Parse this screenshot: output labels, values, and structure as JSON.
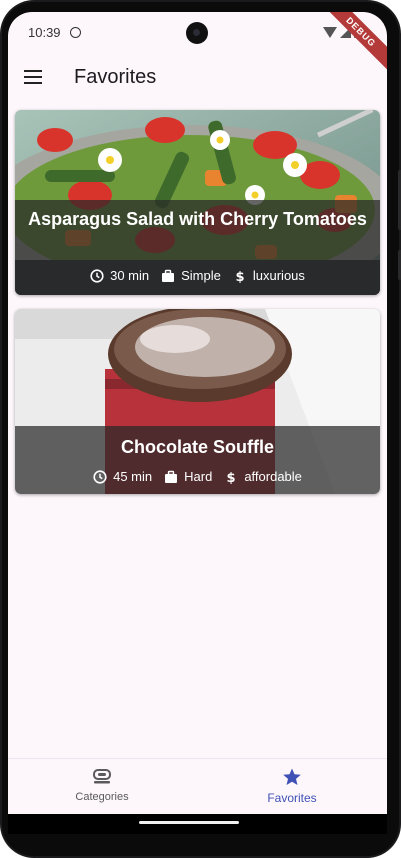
{
  "status_bar": {
    "time": "10:39"
  },
  "debug_banner": "DEBUG",
  "app_bar": {
    "title": "Favorites"
  },
  "meals": [
    {
      "title": "Asparagus Salad with Cherry Tomatoes",
      "duration": "30 min",
      "complexity": "Simple",
      "affordability": "luxurious"
    },
    {
      "title": "Chocolate Souffle",
      "duration": "45 min",
      "complexity": "Hard",
      "affordability": "affordable"
    }
  ],
  "bottom_nav": {
    "items": [
      {
        "label": "Categories",
        "icon": "dinner-dining-icon",
        "selected": false
      },
      {
        "label": "Favorites",
        "icon": "star-icon",
        "selected": true
      }
    ]
  },
  "colors": {
    "accent": "#3f51b5",
    "background": "#fdf7fc",
    "overlay": "#282828"
  }
}
